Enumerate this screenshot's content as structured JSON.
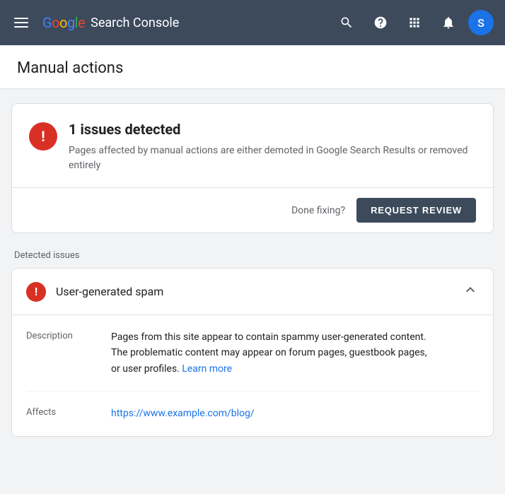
{
  "topnav": {
    "logo_google": "Google",
    "logo_product": "Search Console",
    "icons": {
      "search_label": "Search",
      "help_label": "Help",
      "apps_label": "Apps",
      "notifications_label": "Notifications",
      "avatar_letter": "S"
    }
  },
  "page": {
    "title": "Manual actions"
  },
  "issues_card": {
    "count_label": "1 issues detected",
    "description": "Pages affected by manual actions are either demoted in Google Search Results or removed entirely",
    "done_fixing_label": "Done fixing?",
    "request_review_button": "REQUEST REVIEW"
  },
  "detected_section": {
    "label": "Detected issues",
    "items": [
      {
        "title": "User-generated spam",
        "description": "Pages from this site appear to contain spammy user-generated content. The problematic content may appear on forum pages, guestbook pages, or user profiles.",
        "learn_more_label": "Learn more",
        "learn_more_url": "#",
        "affects_label": "Affects",
        "affects_url": "https://www.example.com/blog/",
        "description_label": "Description"
      }
    ]
  }
}
